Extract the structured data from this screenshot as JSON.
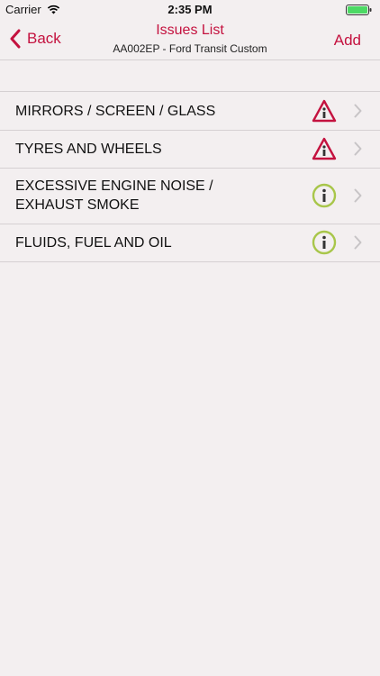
{
  "status_bar": {
    "carrier": "Carrier",
    "time": "2:35 PM",
    "wifi_icon": "wifi-icon",
    "battery_icon": "battery-full-icon"
  },
  "nav": {
    "back_label": "Back",
    "title": "Issues List",
    "subtitle": "AA002EP - Ford Transit Custom",
    "add_label": "Add",
    "accent_color": "#c4123f"
  },
  "issues": [
    {
      "label": "MIRRORS / SCREEN / GLASS",
      "status_icon": "warning-triangle-icon"
    },
    {
      "label": "TYRES AND WHEELS",
      "status_icon": "warning-triangle-icon"
    },
    {
      "label": "EXCESSIVE ENGINE NOISE /\nEXHAUST SMOKE",
      "status_icon": "info-circle-icon"
    },
    {
      "label": "FLUIDS, FUEL AND OIL",
      "status_icon": "info-circle-icon"
    }
  ],
  "colors": {
    "warning": "#c4123f",
    "info": "#a8c64a",
    "background": "#f3eff0"
  }
}
